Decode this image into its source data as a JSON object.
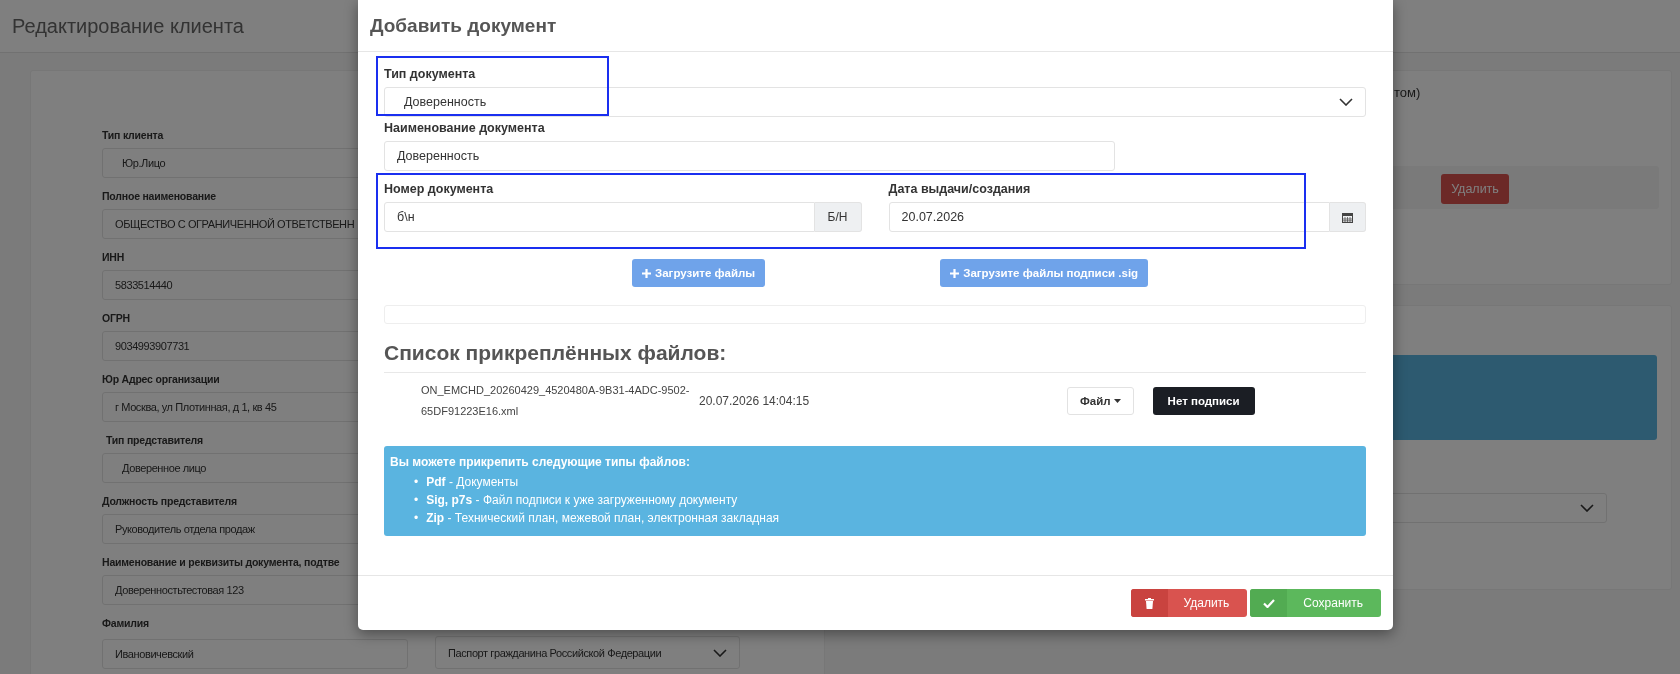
{
  "page": {
    "title": "Редактирование клиента"
  },
  "client_form": {
    "fields": [
      {
        "label": "Тип клиента",
        "value": "Юр.Лицо",
        "kind": "select"
      },
      {
        "label": "Полное наименование",
        "value": "ОБЩЕСТВО С ОГРАНИЧЕННОЙ ОТВЕТСТВЕНН",
        "kind": "input"
      },
      {
        "label": "ИНН",
        "value": "5833514440",
        "kind": "input"
      },
      {
        "label": "ОГРН",
        "value": "9034993907731",
        "kind": "input"
      },
      {
        "label": "Юр Адрес организации",
        "value": "г Москва, ул Плотинная, д 1, кв 45",
        "kind": "input"
      },
      {
        "label": "Тип представителя",
        "value": "Доверенное лицо",
        "kind": "select"
      },
      {
        "label": "Должность представителя",
        "value": "Руководитель отдела продаж",
        "kind": "input"
      },
      {
        "label": "Наименование и реквизиты документа, подтве",
        "value": "Доверенностьтестовая 123",
        "kind": "input"
      }
    ],
    "last_row": {
      "label": "Фамилия",
      "value": "Ивановичевский",
      "passport_select": "Паспорт гражданина Российской Федерации"
    }
  },
  "right_panel": {
    "text_fragment": "том)",
    "delete_button": "Удалить"
  },
  "modal": {
    "title": "Добавить документ",
    "doc_type": {
      "label": "Тип документа",
      "value": "Доверенность",
      "highlighted": true
    },
    "doc_name": {
      "label": "Наименование документа",
      "value": "Доверенность"
    },
    "number_date": {
      "highlighted": true,
      "number": {
        "label": "Номер документа",
        "value": "б\\н",
        "addon": "Б/Н"
      },
      "date": {
        "label": "Дата выдачи/создания",
        "value": "20.07.2026"
      }
    },
    "upload_buttons": [
      {
        "label": "Загрузите файлы"
      },
      {
        "label": "Загрузите файлы подписи .sig"
      }
    ],
    "files_heading": "Список прикреплённых файлов:",
    "files": [
      {
        "name": "ON_EMCHD_20260429_4520480A-9B31-4ADC-9502-65DF91223E16.xml",
        "date": "20.07.2026 14:04:15",
        "file_button": "Файл",
        "signature_button": "Нет подписи"
      }
    ],
    "info": {
      "title": "Вы можете прикрепить следующие типы файлов:",
      "items": [
        {
          "marker": "•",
          "text": "**Pdf** - Документы"
        },
        {
          "marker": "•",
          "text": "**Sig, p7s** - Файл подписи к уже загруженному документу"
        },
        {
          "marker": "•",
          "text": "**Zip** - Технический план, межевой план, электронная закладная"
        }
      ]
    },
    "footer_buttons": [
      {
        "label": "Удалить",
        "kind": "danger"
      },
      {
        "label": "Сохранить",
        "kind": "success"
      }
    ]
  }
}
